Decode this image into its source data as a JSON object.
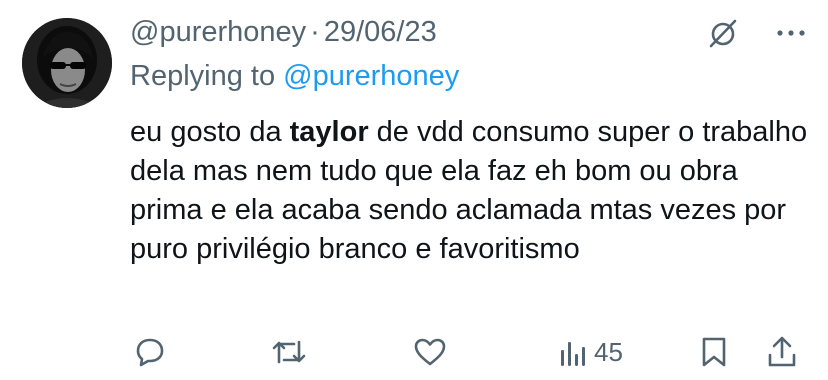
{
  "tweet": {
    "handle": "@purerhoney",
    "separator": "·",
    "date": "29/06/23",
    "replying_prefix": "Replying to",
    "replying_handle": "@purerhoney",
    "text_before": "eu gosto da ",
    "text_bold": "taylor",
    "text_after": " de vdd consumo super o trabalho dela mas nem tudo que ela faz eh bom ou obra prima e ela acaba sendo aclamada mtas vezes por puro privilégio branco e favoritismo"
  },
  "actions": {
    "reply_icon": "comment-icon",
    "retweet_icon": "retweet-icon",
    "like_icon": "heart-icon",
    "views_icon": "views-chart-icon",
    "views_count": "45",
    "bookmark_icon": "bookmark-icon",
    "share_icon": "share-icon"
  },
  "colors": {
    "text": "#0f1419",
    "muted": "#536471",
    "link": "#1d9bf0"
  }
}
